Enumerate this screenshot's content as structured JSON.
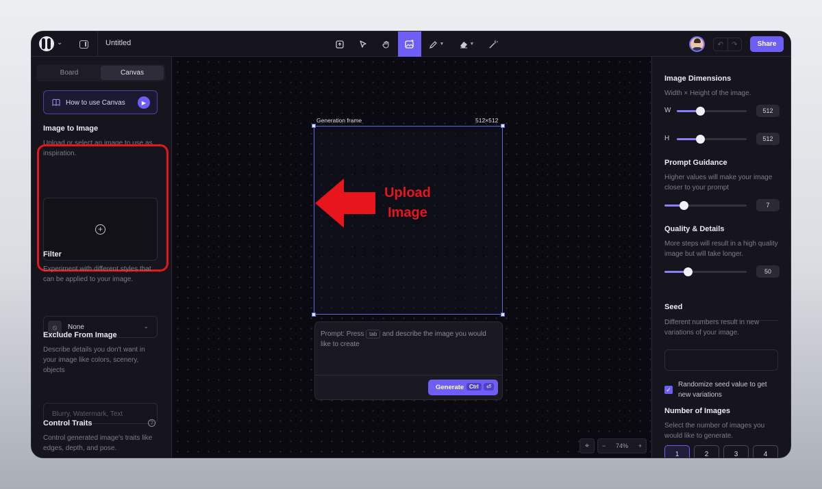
{
  "topbar": {
    "doc_title": "Untitled",
    "share_label": "Share",
    "tools": [
      {
        "icon": "upload-frame-icon"
      },
      {
        "icon": "cursor-icon"
      },
      {
        "icon": "hand-icon"
      },
      {
        "icon": "image-generate-icon",
        "active": true
      },
      {
        "icon": "pencil-icon"
      },
      {
        "icon": "eraser-icon"
      },
      {
        "icon": "magic-wand-icon"
      }
    ]
  },
  "left": {
    "tabs": [
      "Board",
      "Canvas"
    ],
    "active_tab": "Canvas",
    "howto_label": "How to use Canvas",
    "image_to_image": {
      "title": "Image to Image",
      "desc": "Upload or select an image to use as inspiration."
    },
    "filter": {
      "title": "Filter",
      "desc": "Experiment with different styles that can be applied to your image.",
      "value": "None"
    },
    "exclude": {
      "title": "Exclude From Image",
      "desc": "Describe details you don't want in your image like colors, scenery, objects",
      "placeholder": "Blurry, Watermark, Text"
    },
    "control_traits": {
      "title": "Control Traits",
      "desc": "Control generated image's traits like edges, depth, and pose."
    }
  },
  "canvas": {
    "frame_label": "Generation frame",
    "frame_size": "512×512",
    "prompt_part1": "Prompt: Press",
    "prompt_key": "tab",
    "prompt_part2": "and describe the image you would like to create",
    "generate_label": "Generate",
    "generate_key1": "Ctrl",
    "generate_key2": "⏎",
    "zoom": "74%",
    "zoom_minus": "−",
    "zoom_plus": "+"
  },
  "annotation": {
    "text": "Upload Image",
    "color": "#e8151c"
  },
  "right": {
    "dimensions": {
      "title": "Image Dimensions",
      "desc": "Width × Height of the image.",
      "w_label": "W",
      "w_value": "512",
      "h_label": "H",
      "h_value": "512"
    },
    "guidance": {
      "title": "Prompt Guidance",
      "desc": "Higher values will make your image closer to your prompt",
      "value": "7"
    },
    "quality": {
      "title": "Quality & Details",
      "desc": "More steps will result in a high quality image but will take longer.",
      "value": "50"
    },
    "seed": {
      "title": "Seed",
      "desc": "Different numbers result in new variations of your image.",
      "randomize_label": "Randomize seed value to get new variations",
      "randomize_checked": true
    },
    "num_images": {
      "title": "Number of Images",
      "desc": "Select the number of images you would like to generate.",
      "options": [
        "1",
        "2",
        "3",
        "4"
      ],
      "selected": "1"
    }
  },
  "colors": {
    "accent": "#6d5ef5",
    "background": "#0d0c13",
    "frame": "#5a6fe0"
  }
}
